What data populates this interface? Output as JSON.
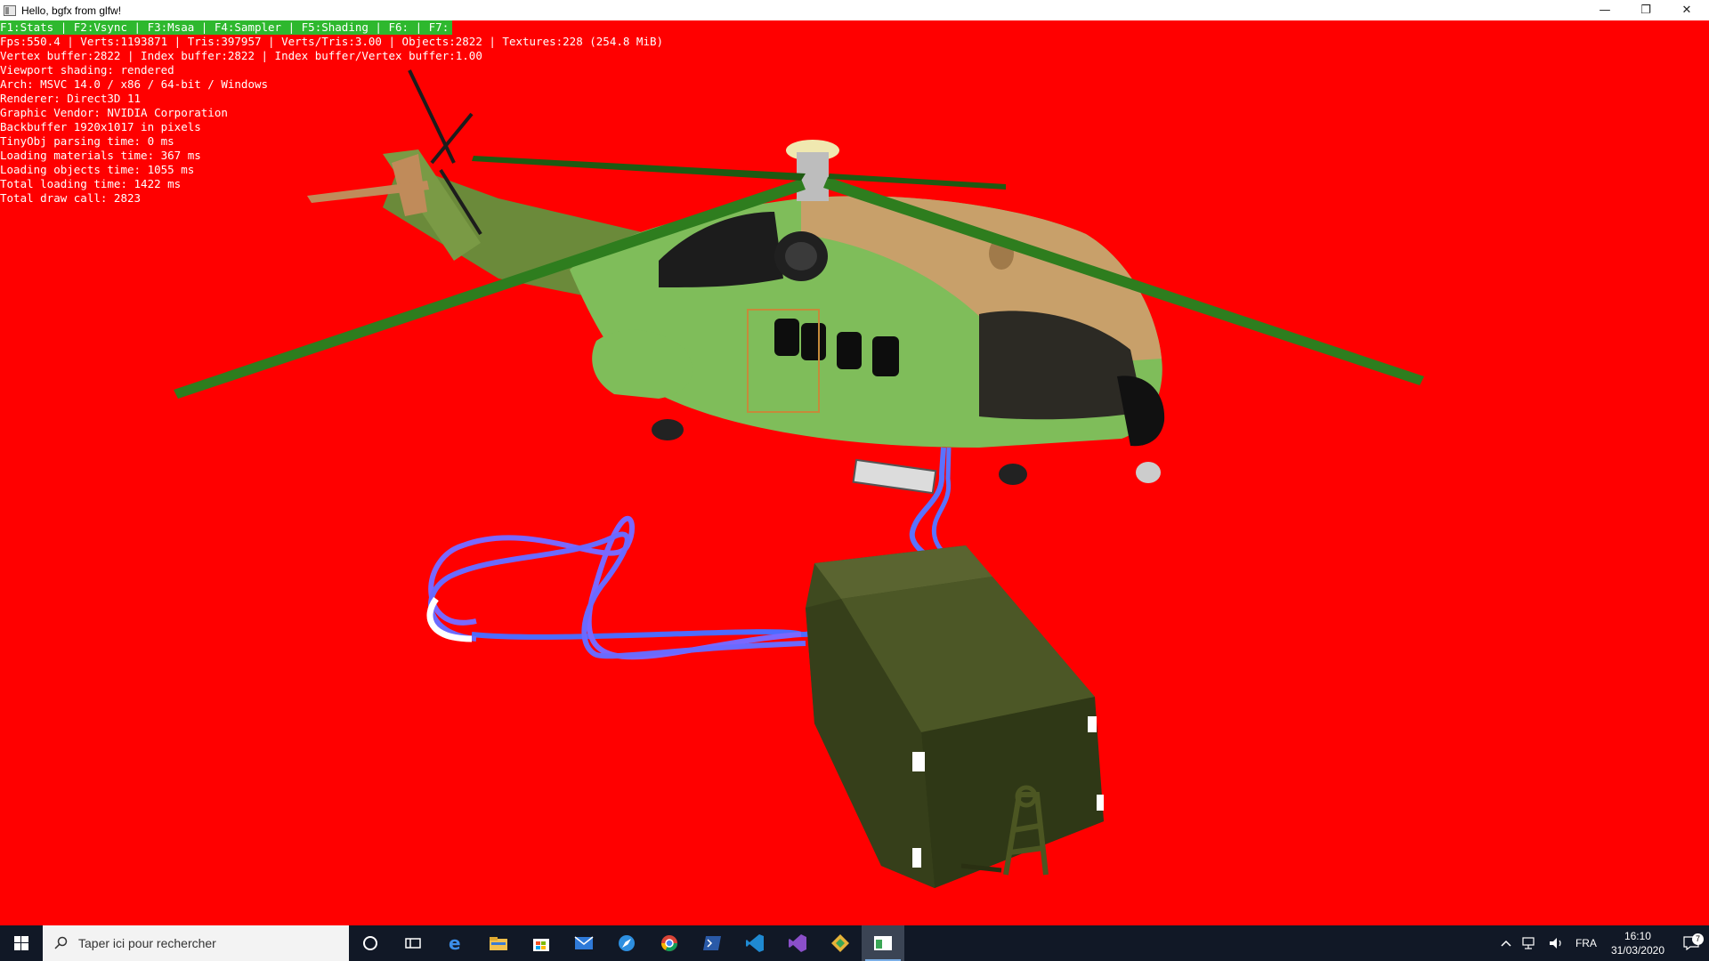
{
  "window": {
    "title": "Hello, bgfx from glfw!",
    "minimize_glyph": "—",
    "maximize_glyph": "❐",
    "close_glyph": "✕"
  },
  "debug": {
    "fkeys": "F1:Stats | F2:Vsync | F3:Msaa | F4:Sampler | F5:Shading | F6: | F7:",
    "lines": [
      "Fps:550.4 | Verts:1193871 | Tris:397957 | Verts/Tris:3.00 | Objects:2822 | Textures:228 (254.8 MiB)",
      "Vertex buffer:2822 | Index buffer:2822 | Index buffer/Vertex buffer:1.00",
      "Viewport shading: rendered",
      "Arch: MSVC 14.0 / x86 / 64-bit / Windows",
      "Renderer: Direct3D 11",
      "Graphic Vendor: NVIDIA Corporation",
      "Backbuffer 1920x1017 in pixels",
      "TinyObj parsing time: 0 ms",
      "Loading materials time: 367 ms",
      "Loading objects time: 1055 ms",
      "Total loading time: 1422 ms",
      "Total draw call: 2823"
    ]
  },
  "taskbar": {
    "search_placeholder": "Taper ici pour rechercher",
    "icons": [
      "cortana-icon",
      "task-view-icon",
      "edge-icon",
      "file-explorer-icon",
      "store-icon",
      "mail-icon",
      "safari-icon",
      "chrome-icon",
      "powershell-icon",
      "vscode-icon",
      "visual-studio-icon",
      "app-icon-diamond",
      "bgfx-window-icon"
    ],
    "language": "FRA",
    "time": "16:10",
    "date": "31/03/2020",
    "notifications": "7"
  },
  "colors": {
    "background": "#ff0000",
    "overlay_text": "#ffffff",
    "fkey_bar": "#2eb82e",
    "taskbar": "#111826"
  }
}
